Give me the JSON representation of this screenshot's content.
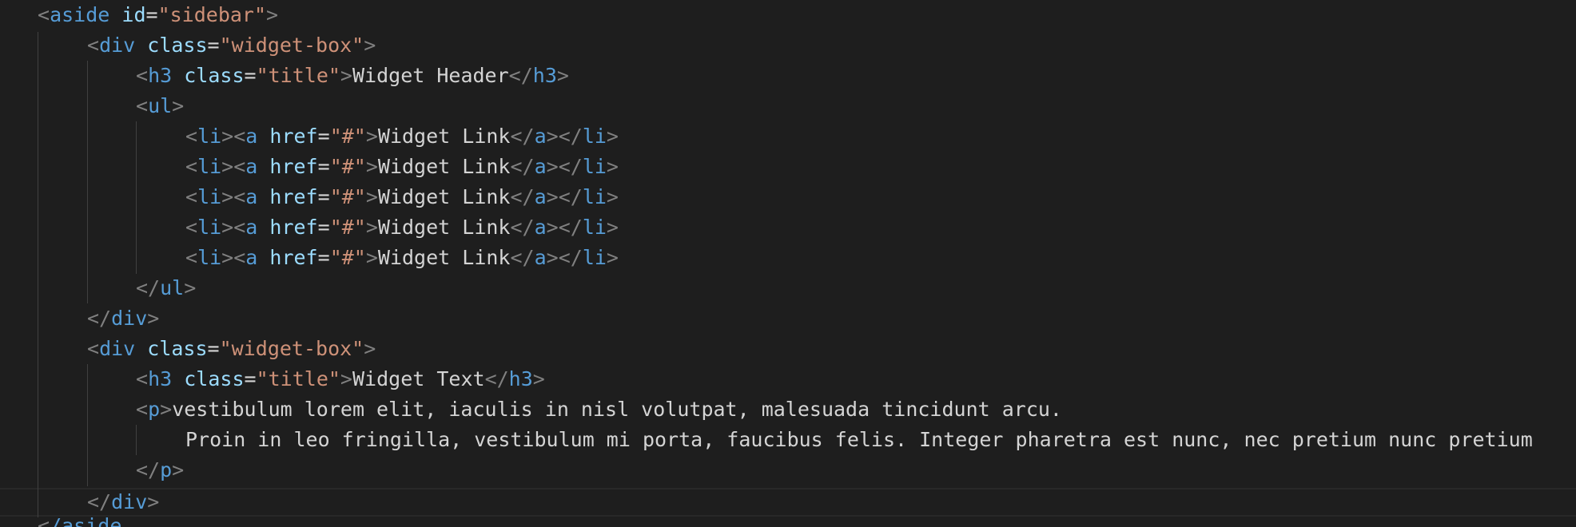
{
  "theme": {
    "background": "#1e1e1e",
    "tag_bracket": "#808080",
    "tag_name": "#569cd6",
    "attribute": "#9cdcfe",
    "string": "#ce9178",
    "text": "#d4d4d4"
  },
  "code": {
    "l1": {
      "tag": "aside",
      "attr": "id",
      "value": "\"sidebar\""
    },
    "l2": {
      "tag": "div",
      "attr": "class",
      "value": "\"widget-box\""
    },
    "l3": {
      "tag": "h3",
      "attr": "class",
      "value": "\"title\"",
      "text": "Widget Header",
      "close": "h3"
    },
    "l4": {
      "tag": "ul"
    },
    "l5": {
      "tag1": "li",
      "tag2": "a",
      "attr": "href",
      "value": "\"#\"",
      "text": "Widget Link",
      "close1": "a",
      "close2": "li"
    },
    "l6": {
      "tag1": "li",
      "tag2": "a",
      "attr": "href",
      "value": "\"#\"",
      "text": "Widget Link",
      "close1": "a",
      "close2": "li"
    },
    "l7": {
      "tag1": "li",
      "tag2": "a",
      "attr": "href",
      "value": "\"#\"",
      "text": "Widget Link",
      "close1": "a",
      "close2": "li"
    },
    "l8": {
      "tag1": "li",
      "tag2": "a",
      "attr": "href",
      "value": "\"#\"",
      "text": "Widget Link",
      "close1": "a",
      "close2": "li"
    },
    "l9": {
      "tag1": "li",
      "tag2": "a",
      "attr": "href",
      "value": "\"#\"",
      "text": "Widget Link",
      "close1": "a",
      "close2": "li"
    },
    "l10": {
      "close": "ul"
    },
    "l11": {
      "close": "div"
    },
    "l12": {
      "tag": "div",
      "attr": "class",
      "value": "\"widget-box\""
    },
    "l13": {
      "tag": "h3",
      "attr": "class",
      "value": "\"title\"",
      "text": "Widget Text",
      "close": "h3"
    },
    "l14": {
      "tag": "p",
      "text": "vestibulum lorem elit, iaculis in nisl volutpat, malesuada tincidunt arcu."
    },
    "l15": {
      "text": "Proin in leo fringilla, vestibulum mi porta, faucibus felis. Integer pharetra est nunc, nec pretium nunc pretium"
    },
    "l16": {
      "close": "p"
    },
    "l17": {
      "close": "div"
    },
    "l18": {
      "close_partial": "/aside"
    }
  }
}
